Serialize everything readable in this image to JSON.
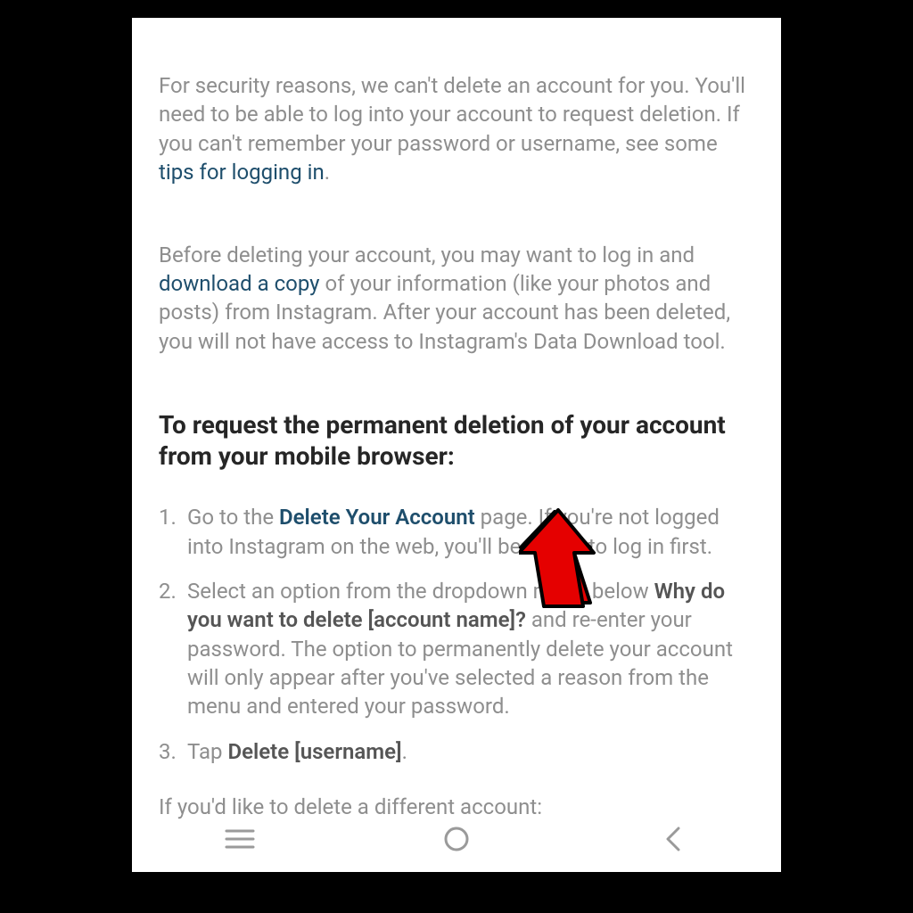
{
  "p1_a": "For security reasons, we can't delete an account for you. You'll need to be able to log into your account to request deletion. If you can't remember your password or username, see some ",
  "p1_link": "tips for logging in",
  "p1_b": ".",
  "p2_a": "Before deleting your account, you may want to log in and ",
  "p2_link": "download a copy",
  "p2_b": " of your information (like your photos and posts) from Instagram. After your account has been deleted, you will not have access to Instagram's Data Download tool.",
  "heading": "To request the permanent deletion of your account from your mobile browser:",
  "li1_a": "Go to the ",
  "li1_link": "Delete Your Account",
  "li1_b": " page. If you're not logged into Instagram on the web, you'll be asked to log in first.",
  "li2_a": "Select an option from the dropdown menu below ",
  "li2_bold": "Why do you want to delete [account name]?",
  "li2_b": " and re-enter your password. The option to permanently delete your account will only appear after you've selected a reason from the menu and entered your password.",
  "li3_a": "Tap ",
  "li3_bold": "Delete [username]",
  "li3_b": ".",
  "closing": "If you'd like to delete a different account:"
}
